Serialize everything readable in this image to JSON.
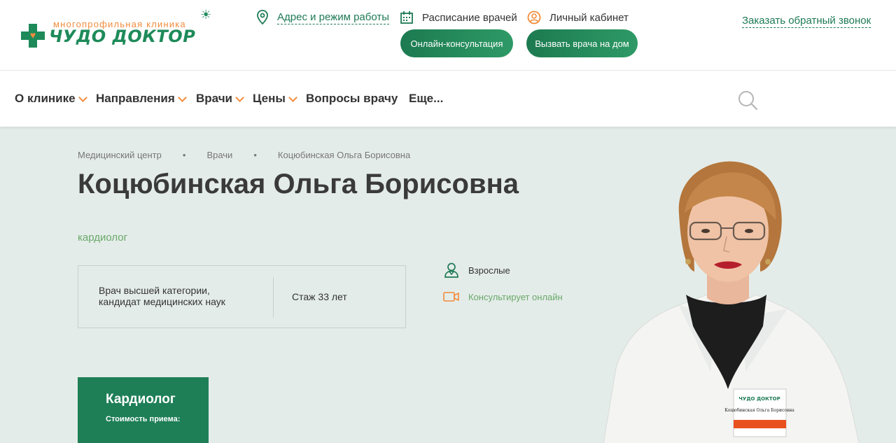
{
  "header": {
    "logo_sub": "многопрофильная клиника",
    "logo_name": "ЧУДО ДОКТОР",
    "address_link": "Адрес и режим работы",
    "schedule_link": "Расписание врачей",
    "cabinet_link": "Личный кабинет",
    "callback_link": "Заказать обратный звонок",
    "online_button": "Онлайн-консультация",
    "home_button": "Вызвать врача на дом"
  },
  "nav": {
    "items": [
      {
        "label": "О клинике"
      },
      {
        "label": "Направления"
      },
      {
        "label": "Врачи"
      },
      {
        "label": "Цены"
      },
      {
        "label": "Вопросы врачу"
      },
      {
        "label": "Еще..."
      }
    ]
  },
  "breadcrumb": [
    "Медицинский центр",
    "Врачи",
    "Коцюбинская Ольга Борисовна"
  ],
  "doctor": {
    "name": "Коцюбинская Ольга Борисовна",
    "specialty": "кардиолог",
    "category": "Врач высшей категории, кандидат медицинских наук",
    "experience": "Стаж 33 лет",
    "patients": "Взрослые",
    "online": "Консультирует онлайн",
    "badge_clinic": "ЧУДО ДОКТОР",
    "badge_name": "Коцюбинская Ольга Борисовна"
  },
  "price_card": {
    "title": "Кардиолог",
    "subtitle": "Стоимость приема:"
  },
  "colors": {
    "brand_green": "#1e8a5a",
    "accent_orange": "#f28c3c",
    "background": "#e4ece9"
  }
}
